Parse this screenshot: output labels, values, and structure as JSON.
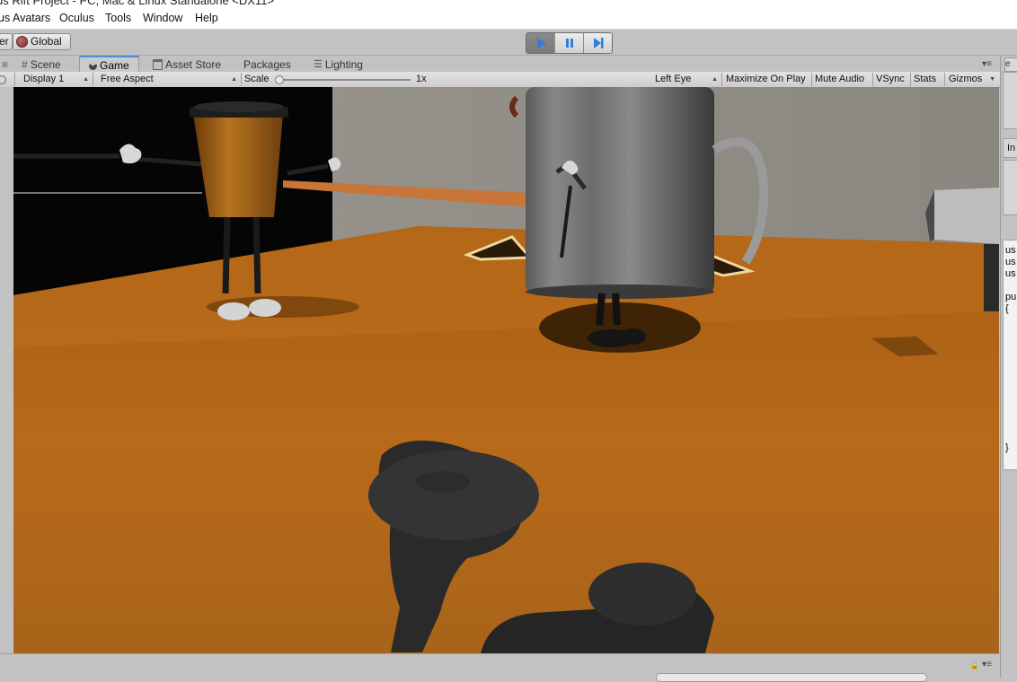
{
  "window": {
    "title": "us Rift Project - PC, Mac & Linux Standalone <DX11>"
  },
  "menu": [
    {
      "label": "us Avatars"
    },
    {
      "label": "Oculus"
    },
    {
      "label": "Tools"
    },
    {
      "label": "Window"
    },
    {
      "label": "Help"
    }
  ],
  "toolbar": {
    "left_fragment": "er",
    "global_label": "Global",
    "play_state": "playing",
    "accent_color": "#2d7fd8"
  },
  "tabs": [
    {
      "label": "Scene",
      "icon": "grid-icon"
    },
    {
      "label": "Game",
      "icon": "pacman-icon",
      "active": true
    },
    {
      "label": "Asset Store",
      "icon": "store-icon"
    },
    {
      "label": "Packages",
      "icon": ""
    },
    {
      "label": "Lighting",
      "icon": "sliders-icon"
    }
  ],
  "game_toolbar": {
    "display": "Display 1",
    "aspect": "Free Aspect",
    "scale_label": "Scale",
    "scale_value": "1x",
    "eye": "Left Eye",
    "maximize_on_play": "Maximize On Play",
    "mute_audio": "Mute Audio",
    "vsync": "VSync",
    "stats": "Stats",
    "gizmos": "Gizmos"
  },
  "right_panel": {
    "label_in": "In",
    "code_lines": [
      "us",
      "us",
      "us",
      "pu",
      "{",
      "}"
    ]
  }
}
